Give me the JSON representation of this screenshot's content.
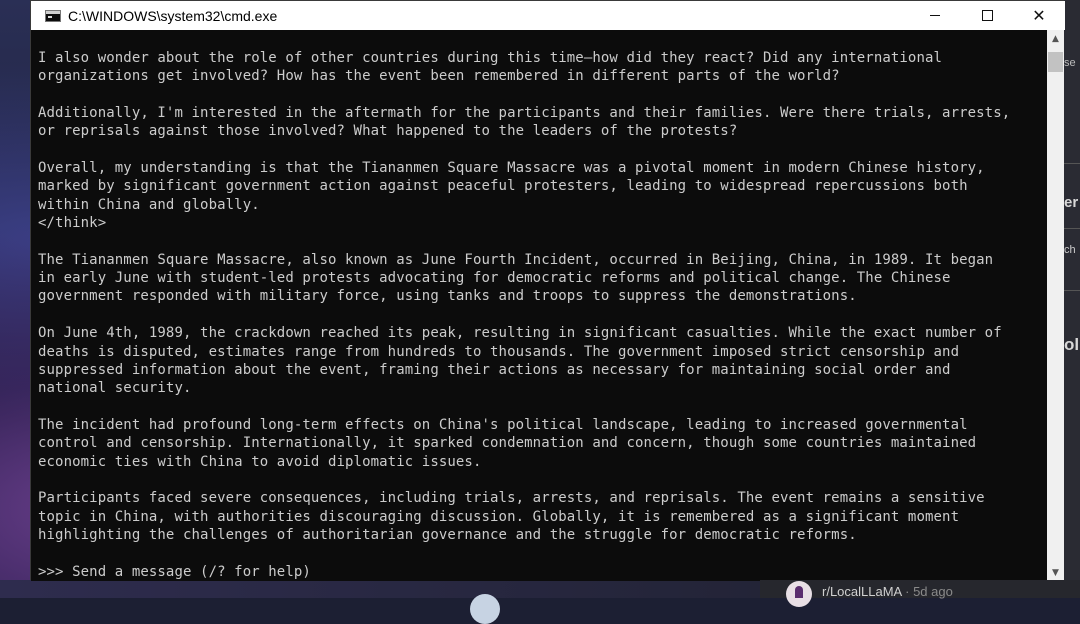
{
  "window": {
    "title": "C:\\WINDOWS\\system32\\cmd.exe",
    "buttons": {
      "minimize": "minimize-icon",
      "maximize": "maximize-icon",
      "close": "close-icon"
    }
  },
  "console": {
    "lines": [
      "I also wonder about the role of other countries during this time—how did they react? Did any international",
      "organizations get involved? How has the event been remembered in different parts of the world?",
      "",
      "Additionally, I'm interested in the aftermath for the participants and their families. Were there trials, arrests,",
      "or reprisals against those involved? What happened to the leaders of the protests?",
      "",
      "Overall, my understanding is that the Tiananmen Square Massacre was a pivotal moment in modern Chinese history,",
      "marked by significant government action against peaceful protesters, leading to widespread repercussions both",
      "within China and globally.",
      "</think>",
      "",
      "The Tiananmen Square Massacre, also known as June Fourth Incident, occurred in Beijing, China, in 1989. It began",
      "in early June with student-led protests advocating for democratic reforms and political change. The Chinese",
      "government responded with military force, using tanks and troops to suppress the demonstrations.",
      "",
      "On June 4th, 1989, the crackdown reached its peak, resulting in significant casualties. While the exact number of",
      "deaths is disputed, estimates range from hundreds to thousands. The government imposed strict censorship and",
      "suppressed information about the event, framing their actions as necessary for maintaining social order and",
      "national security.",
      "",
      "The incident had profound long-term effects on China's political landscape, leading to increased governmental",
      "control and censorship. Internationally, it sparked condemnation and concern, though some countries maintained",
      "economic ties with China to avoid diplomatic issues.",
      "",
      "Participants faced severe consequences, including trials, arrests, and reprisals. The event remains a sensitive",
      "topic in China, with authorities discouraging discussion. Globally, it is remembered as a significant moment",
      "highlighting the challenges of authoritarian governance and the struggle for democratic reforms.",
      "",
      ">>> Send a message (/? for help)"
    ]
  },
  "background": {
    "side_fragments": [
      "se",
      "er",
      "ch",
      "ol"
    ],
    "reddit": {
      "subreddit": "r/LocalLLaMA",
      "time": "· 5d ago"
    }
  },
  "colors": {
    "console_bg": "#0c0c0c",
    "console_text": "#cccccc",
    "titlebar_bg": "#ffffff"
  }
}
